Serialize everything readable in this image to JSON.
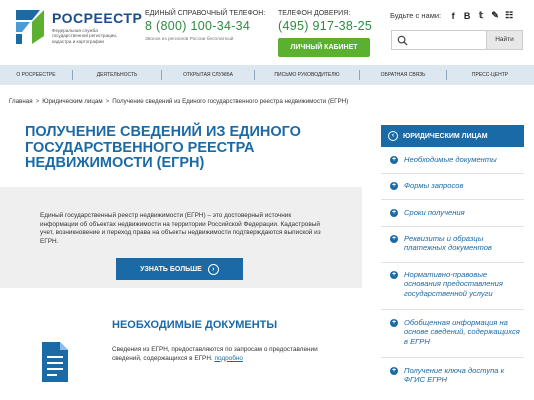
{
  "header": {
    "brand_name": "РОСРЕЕСТР",
    "brand_sub": "Федеральная служба государственной регистрации, кадастра и картографии",
    "helpline_label": "ЕДИНЫЙ СПРАВОЧНЫЙ ТЕЛЕФОН:",
    "helpline_number": "8 (800) 100-34-34",
    "helpline_note": "Звонок из регионов России бесплатный",
    "trust_label": "ТЕЛЕФОН ДОВЕРИЯ:",
    "trust_number": "(495) 917-38-25",
    "cabinet_label": "ЛИЧНЫЙ КАБИНЕТ",
    "social_label": "Будьте с нами:",
    "social": [
      "f",
      "B",
      "t",
      "yt",
      "rss"
    ],
    "search_placeholder": "",
    "search_button": "Найти"
  },
  "nav": {
    "items": [
      "О РОСРЕЕСТРЕ",
      "ДЕЯТЕЛЬНОСТЬ",
      "ОТКРЫТАЯ СЛУЖБА",
      "ПИСЬМО РУКОВОДИТЕЛЮ",
      "ОБРАТНАЯ СВЯЗЬ",
      "ПРЕСС-ЦЕНТР"
    ]
  },
  "breadcrumb": {
    "items": [
      "Главная",
      "Юридическим лицам",
      "Получение сведений из Единого государственного реестра недвижимости (ЕГРН)"
    ],
    "sep": ">"
  },
  "main": {
    "title": "ПОЛУЧЕНИЕ СВЕДЕНИЙ ИЗ ЕДИНОГО ГОСУДАРСТВЕННОГО РЕЕСТРА НЕДВИЖИМОСТИ (ЕГРН)",
    "info_text": "Единый государственный реестр недвижимости (ЕГРН) – это достоверный источник информации об объектах недвижимости на территории Российской Федерации. Кадастровый учет, возникновение и переход права на объекты недвижимости подтверждаются выпиской из ЕГРН.",
    "more_button": "УЗНАТЬ БОЛЬШЕ",
    "docs_title": "НЕОБХОДИМЫЕ ДОКУМЕНТЫ",
    "docs_text": "Сведения из ЕГРН, предоставляются по запросам о предоставлении сведений, содержащихся в ЕГРН.",
    "docs_link": "подробно"
  },
  "sidebar": {
    "head": "ЮРИДИЧЕСКИМ ЛИЦАМ",
    "items": [
      {
        "label": "Необходимые документы"
      },
      {
        "label": "Формы запросов"
      },
      {
        "label": "Сроки получения"
      },
      {
        "label": "Реквизиты и образцы платежных документов"
      },
      {
        "label": "Нормативно-правовые основания предоставления государственной услуги"
      },
      {
        "label": "Обобщенная информация на основе сведений, содержащихся в ЕГРН"
      },
      {
        "label": "Получение ключа доступа к ФГИС ЕГРН"
      }
    ]
  },
  "colors": {
    "brand_blue": "#1a6aa8",
    "phone_green": "#2e8a3e",
    "cabinet_green": "#5cb030",
    "nav_bg": "#dde7ef",
    "info_bg": "#efefef"
  }
}
